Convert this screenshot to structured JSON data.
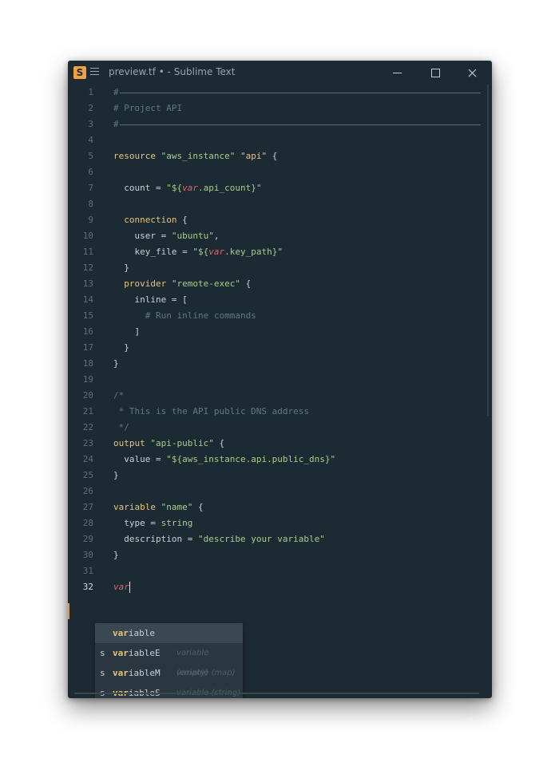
{
  "window": {
    "title": "preview.tf • - Sublime Text",
    "app_icon_glyph": "S",
    "accent": "#f0a040"
  },
  "editor": {
    "active_line": 32,
    "lines": [
      {
        "n": "1",
        "rule": true,
        "tokens": [
          {
            "t": "#",
            "c": "comment"
          }
        ]
      },
      {
        "n": "2",
        "tokens": [
          {
            "t": "# Project API",
            "c": "comment"
          }
        ]
      },
      {
        "n": "3",
        "rule": true,
        "tokens": [
          {
            "t": "#",
            "c": "comment"
          }
        ]
      },
      {
        "n": "4",
        "tokens": []
      },
      {
        "n": "5",
        "tokens": [
          {
            "t": "resource ",
            "c": "kw"
          },
          {
            "t": "\"aws_instance\"",
            "c": "str"
          },
          {
            "t": " ",
            "c": "plain"
          },
          {
            "t": "\"api\"",
            "c": "kw"
          },
          {
            "t": " {",
            "c": "punct"
          }
        ]
      },
      {
        "n": "6",
        "tokens": []
      },
      {
        "n": "7",
        "tokens": [
          {
            "t": "  count = ",
            "c": "plain"
          },
          {
            "t": "\"${",
            "c": "str"
          },
          {
            "t": "var",
            "c": "var"
          },
          {
            "t": ".api_count}\"",
            "c": "str"
          }
        ]
      },
      {
        "n": "8",
        "tokens": []
      },
      {
        "n": "9",
        "tokens": [
          {
            "t": "  connection",
            "c": "kw"
          },
          {
            "t": " {",
            "c": "punct"
          }
        ]
      },
      {
        "n": "10",
        "tokens": [
          {
            "t": "    user = ",
            "c": "plain"
          },
          {
            "t": "\"ubuntu\"",
            "c": "str"
          },
          {
            "t": ",",
            "c": "punct"
          }
        ]
      },
      {
        "n": "11",
        "tokens": [
          {
            "t": "    key_file = ",
            "c": "plain"
          },
          {
            "t": "\"${",
            "c": "str"
          },
          {
            "t": "var",
            "c": "var"
          },
          {
            "t": ".key_path}\"",
            "c": "str"
          }
        ]
      },
      {
        "n": "12",
        "tokens": [
          {
            "t": "  }",
            "c": "punct"
          }
        ]
      },
      {
        "n": "13",
        "tokens": [
          {
            "t": "  provider ",
            "c": "kw"
          },
          {
            "t": "\"remote-exec\"",
            "c": "str"
          },
          {
            "t": " {",
            "c": "punct"
          }
        ]
      },
      {
        "n": "14",
        "tokens": [
          {
            "t": "    inline = [",
            "c": "plain"
          }
        ]
      },
      {
        "n": "15",
        "tokens": [
          {
            "t": "      # Run inline commands",
            "c": "comment"
          }
        ]
      },
      {
        "n": "16",
        "tokens": [
          {
            "t": "    ]",
            "c": "punct"
          }
        ]
      },
      {
        "n": "17",
        "tokens": [
          {
            "t": "  }",
            "c": "punct"
          }
        ]
      },
      {
        "n": "18",
        "tokens": [
          {
            "t": "}",
            "c": "punct"
          }
        ]
      },
      {
        "n": "19",
        "tokens": []
      },
      {
        "n": "20",
        "tokens": [
          {
            "t": "/*",
            "c": "comment"
          }
        ]
      },
      {
        "n": "21",
        "tokens": [
          {
            "t": " * This is the API public DNS address",
            "c": "comment"
          }
        ]
      },
      {
        "n": "22",
        "tokens": [
          {
            "t": " */",
            "c": "comment"
          }
        ]
      },
      {
        "n": "23",
        "tokens": [
          {
            "t": "output ",
            "c": "kw"
          },
          {
            "t": "\"api-public\"",
            "c": "str"
          },
          {
            "t": " {",
            "c": "punct"
          }
        ]
      },
      {
        "n": "24",
        "tokens": [
          {
            "t": "  value = ",
            "c": "plain"
          },
          {
            "t": "\"${aws_instance.api.public_dns}\"",
            "c": "str"
          }
        ]
      },
      {
        "n": "25",
        "tokens": [
          {
            "t": "}",
            "c": "punct"
          }
        ]
      },
      {
        "n": "26",
        "tokens": []
      },
      {
        "n": "27",
        "tokens": [
          {
            "t": "variable ",
            "c": "kw"
          },
          {
            "t": "\"name\"",
            "c": "str"
          },
          {
            "t": " {",
            "c": "punct"
          }
        ]
      },
      {
        "n": "28",
        "tokens": [
          {
            "t": "  type = ",
            "c": "plain"
          },
          {
            "t": "string",
            "c": "str"
          }
        ]
      },
      {
        "n": "29",
        "tokens": [
          {
            "t": "  description = ",
            "c": "plain"
          },
          {
            "t": "\"describe your variable\"",
            "c": "str"
          }
        ]
      },
      {
        "n": "30",
        "tokens": [
          {
            "t": "}",
            "c": "punct"
          }
        ]
      },
      {
        "n": "31",
        "tokens": []
      },
      {
        "n": "32",
        "cursor": true,
        "tokens": [
          {
            "t": "var",
            "c": "var"
          }
        ]
      }
    ]
  },
  "autocomplete": {
    "items": [
      {
        "kind": "",
        "match": "var",
        "rest": "iable",
        "hint": "",
        "selected": true
      },
      {
        "kind": "s",
        "match": "var",
        "rest": "iableE",
        "hint": "variable (empty)",
        "selected": false
      },
      {
        "kind": "s",
        "match": "var",
        "rest": "iableM",
        "hint": "variable (map)",
        "selected": false
      },
      {
        "kind": "s",
        "match": "var",
        "rest": "iableS",
        "hint": "variable (string)",
        "selected": false
      }
    ]
  }
}
